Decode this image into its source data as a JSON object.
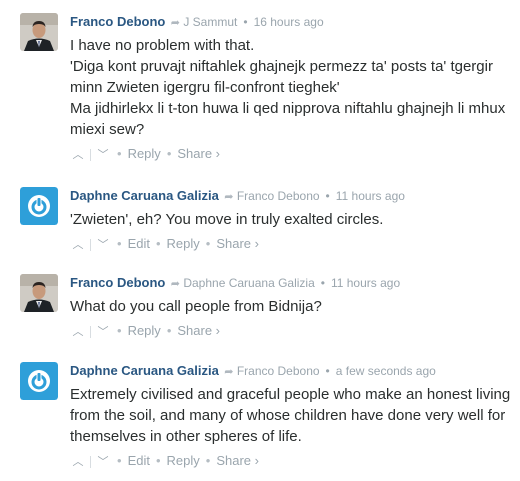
{
  "comments": [
    {
      "author": "Franco Debono",
      "reply_to": "J Sammut",
      "time": "16 hours ago",
      "avatar": "photo",
      "lines": [
        "I have no problem with that.",
        "'Diga kont pruvajt niftahlek ghajnejk permezz ta' posts ta' tgergir minn Zwieten igergru fil-confront tieghek'",
        "Ma jidhirlekx li t-ton huwa li qed nipprova niftahlu ghajnejh li mhux miexi sew?"
      ],
      "actions": {
        "reply": "Reply",
        "share": "Share ›"
      }
    },
    {
      "author": "Daphne Caruana Galizia",
      "reply_to": "Franco Debono",
      "time": "11 hours ago",
      "avatar": "logo",
      "lines": [
        "'Zwieten', eh? You move in truly exalted circles."
      ],
      "actions": {
        "edit": "Edit",
        "reply": "Reply",
        "share": "Share ›"
      }
    },
    {
      "author": "Franco Debono",
      "reply_to": "Daphne Caruana Galizia",
      "time": "11 hours ago",
      "avatar": "photo",
      "lines": [
        "What do you call people from Bidnija?"
      ],
      "actions": {
        "reply": "Reply",
        "share": "Share ›"
      }
    },
    {
      "author": "Daphne Caruana Galizia",
      "reply_to": "Franco Debono",
      "time": "a few seconds ago",
      "avatar": "logo",
      "lines": [
        "Extremely civilised and graceful people who make an honest living from the soil, and many of whose children have done very well for themselves in other spheres of life."
      ],
      "actions": {
        "edit": "Edit",
        "reply": "Reply",
        "share": "Share ›"
      }
    }
  ],
  "icons": {
    "reply_arrow": "reply-arrow-icon",
    "upvote": "chevron-up-icon",
    "downvote": "chevron-down-icon",
    "logo_avatar": "power-icon"
  },
  "colors": {
    "author": "#2a5782",
    "meta": "#9aa5ad",
    "text": "#2a2e2e",
    "logo_avatar_bg": "#2e9fd9"
  }
}
